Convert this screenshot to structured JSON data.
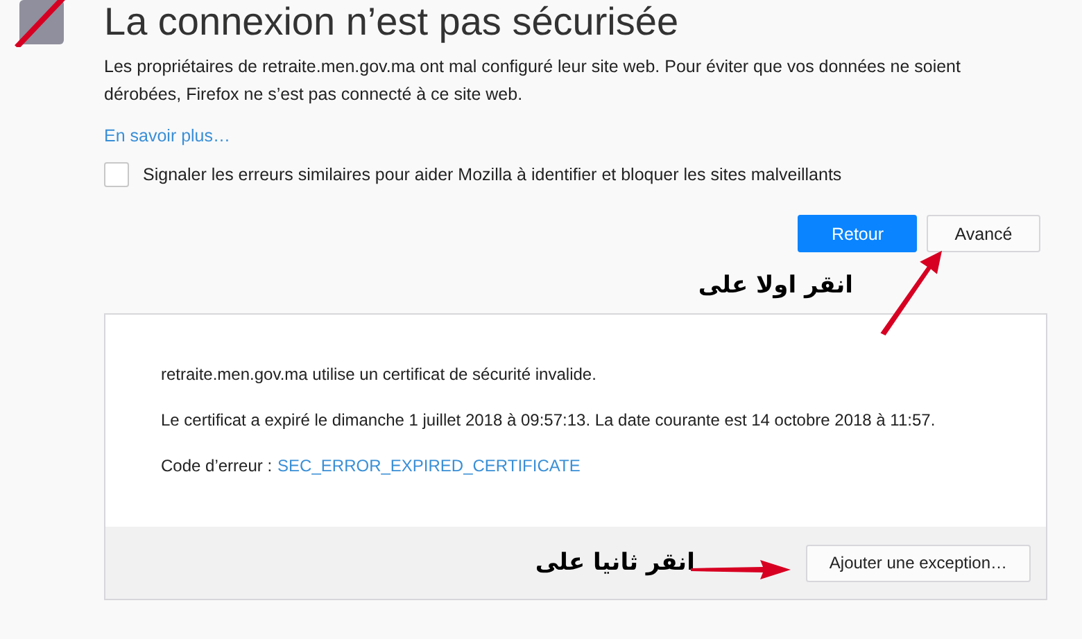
{
  "title": "La connexion n’est pas sécurisée",
  "intro": "Les propriétaires de retraite.men.gov.ma ont mal configuré leur site web. Pour éviter que vos données ne soient dérobées, Firefox ne s’est pas connecté à ce site web.",
  "learn_more": "En savoir plus…",
  "report_checkbox": {
    "label": "Signaler les erreurs similaires pour aider Mozilla à identifier et bloquer les sites malveillants",
    "checked": false
  },
  "buttons": [
    {
      "label": "Retour",
      "kind": "primary"
    },
    {
      "label": "Avancé",
      "kind": "secondary"
    }
  ],
  "annotation_first": "انقر اولا على",
  "details": {
    "lines": [
      "retraite.men.gov.ma utilise un certificat de sécurité invalide.",
      "Le certificat a expiré le dimanche 1 juillet 2018 à 09:57:13. La date courante est 14 octobre 2018 à 11:57."
    ],
    "error_label": "Code d’erreur :",
    "error_code": "SEC_ERROR_EXPIRED_CERTIFICATE",
    "annotation_second": "انقر ثانيا على",
    "exception_button": "Ajouter une exception…"
  }
}
